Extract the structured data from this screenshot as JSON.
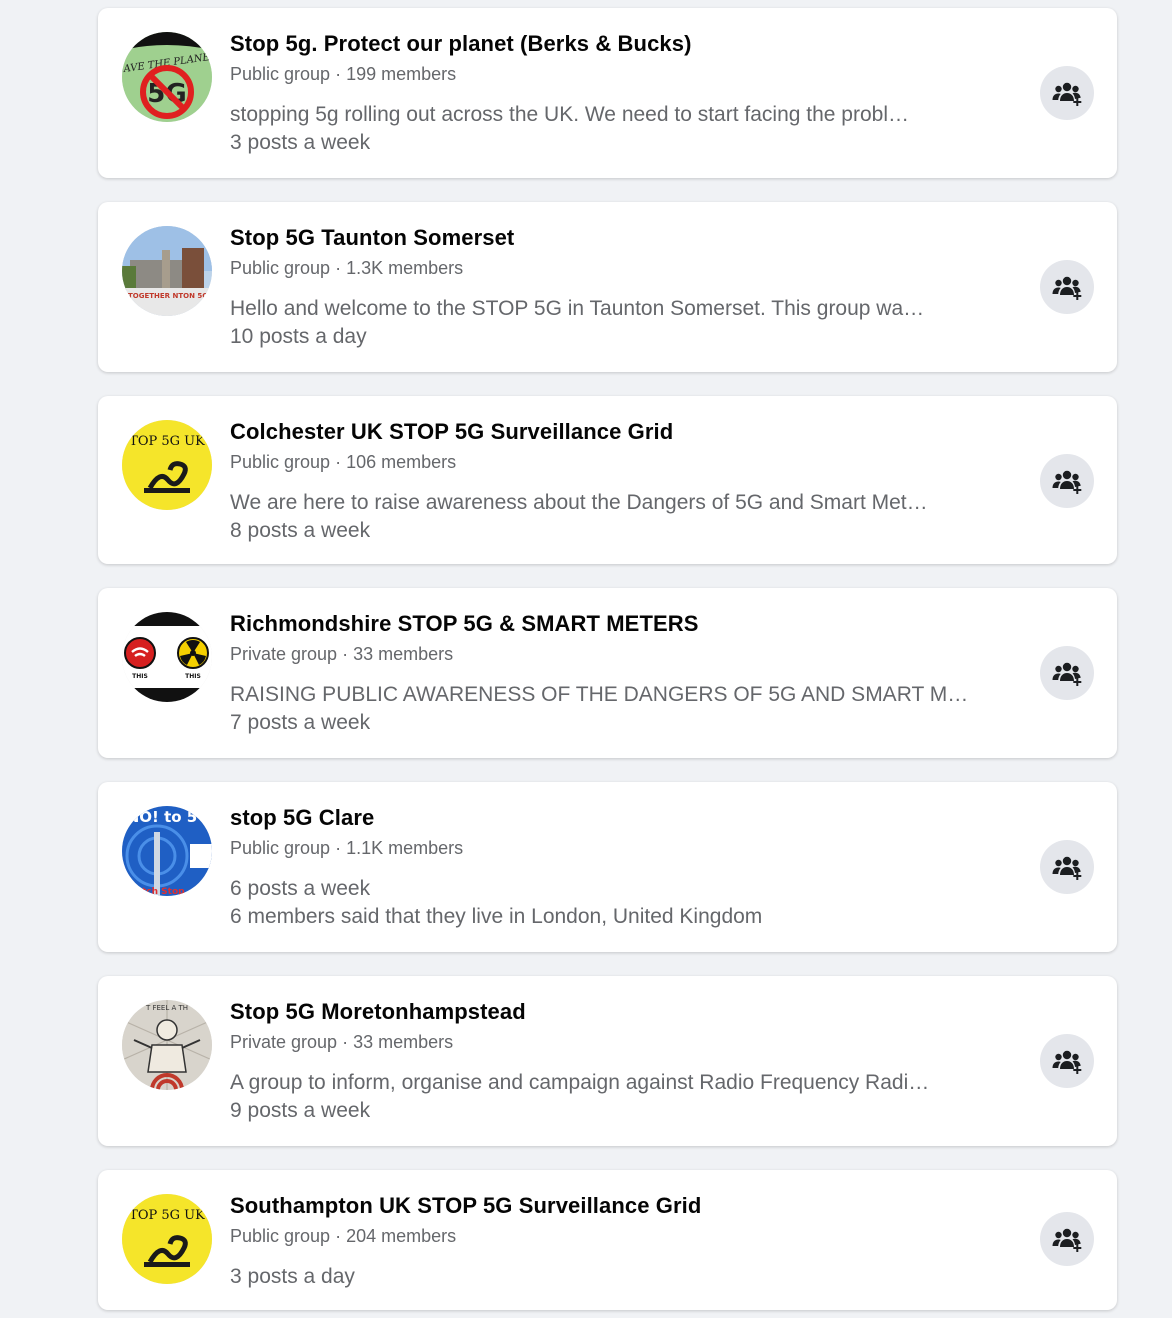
{
  "groups": [
    {
      "name": "Stop 5g. Protect our planet (Berks & Bucks)",
      "privacy": "Public group",
      "members": "199 members",
      "line1": "stopping 5g rolling out across the UK. We need to start facing the probl…",
      "line2": "3 posts a week",
      "avatar": "save-the-planet-no-5g-logo",
      "avatar_text": "SAVE THE PLANET 5G"
    },
    {
      "name": "Stop 5G Taunton Somerset",
      "privacy": "Public group",
      "members": "1.3K members",
      "line1": "Hello and welcome to the STOP 5G in Taunton Somerset. This group wa…",
      "line2": "10 posts a day",
      "avatar": "town-square-photo",
      "avatar_text": "TOGETHER NTON 5G FREE"
    },
    {
      "name": "Colchester UK STOP 5G Surveillance Grid",
      "privacy": "Public group",
      "members": "106 members",
      "line1": "We are here to raise awareness about the Dangers of 5G and Smart Met…",
      "line2": "8 posts a week",
      "avatar": "snake-flag-logo",
      "avatar_text": "TOP 5G UK"
    },
    {
      "name": "Richmondshire STOP 5G & SMART METERS",
      "privacy": "Private group",
      "members": "33 members",
      "line1": "RAISING PUBLIC AWARENESS OF THE DANGERS OF 5G AND SMART M…",
      "line2": "7 posts a week",
      "avatar": "wifi-radiation-logo",
      "avatar_text": "THIS IS THE SAME THIS"
    },
    {
      "name": "stop 5G Clare",
      "privacy": "Public group",
      "members": "1.1K members",
      "line1": "6 posts a week",
      "line2": "6 members said that they live in London, United Kingdom",
      "avatar": "no-to-5g-mast-photo",
      "avatar_text": "NO! to 5"
    },
    {
      "name": "Stop 5G Moretonhampstead",
      "privacy": "Private group",
      "members": "33 members",
      "line1": "A group to inform, organise and campaign against Radio Frequency Radi…",
      "line2": "9 posts a week",
      "avatar": "man-radiation-illustration",
      "avatar_text": "T FEEL A TH"
    },
    {
      "name": "Southampton UK STOP 5G Surveillance Grid",
      "privacy": "Public group",
      "members": "204 members",
      "line1": "",
      "line2": "3 posts a day",
      "avatar": "snake-flag-logo",
      "avatar_text": "TOP 5G UK"
    }
  ],
  "separator": " · ",
  "join_icon": "group-join-icon",
  "colors": {
    "background": "#f0f2f5",
    "card": "#ffffff",
    "title": "#050505",
    "secondary": "#65676b",
    "button": "#e4e6eb",
    "icon": "#1c1e21"
  }
}
